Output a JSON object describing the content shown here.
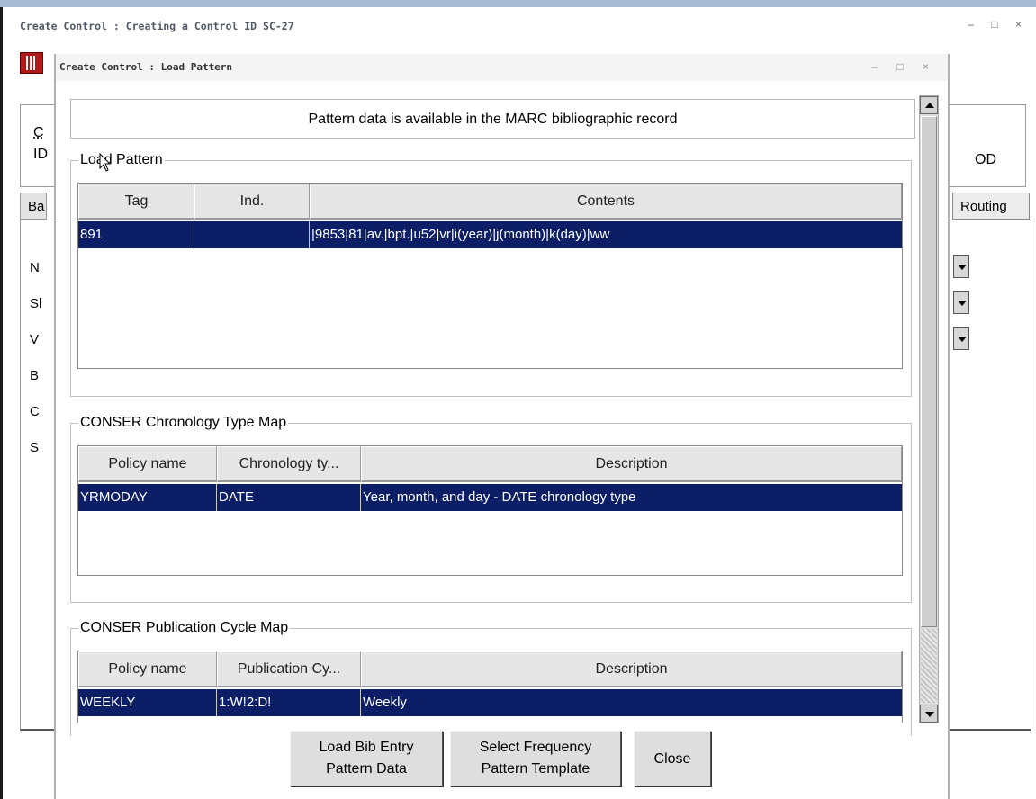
{
  "background_window": {
    "title": "Create Control : Creating a Control ID SC-27",
    "window_controls": "–  □  ×",
    "panel_label_1": "C",
    "panel_label_2": "ID",
    "panel_right_text": "OD",
    "tab_left": "Ba",
    "tab_right": "Routing",
    "side_labels": [
      "N",
      "Sl",
      "V",
      "B",
      "C",
      "S"
    ]
  },
  "dialog": {
    "title": "Create Control : Load Pattern",
    "window_controls": "–  □  ×",
    "info_text": "Pattern data is available in the MARC bibliographic record",
    "load_pattern": {
      "legend": "Load Pattern",
      "columns": [
        "Tag",
        "Ind.",
        "Contents"
      ],
      "rows": [
        {
          "tag": "891",
          "ind": "",
          "contents": "|9853|81|av.|bpt.|u52|vr|i(year)|j(month)|k(day)|ww"
        }
      ]
    },
    "chronology_map": {
      "legend": "CONSER Chronology Type Map",
      "columns": [
        "Policy name",
        "Chronology ty...",
        "Description"
      ],
      "rows": [
        {
          "policy": "YRMODAY",
          "type": "DATE",
          "description": "Year, month, and day - DATE chronology type"
        }
      ]
    },
    "publication_map": {
      "legend": "CONSER Publication Cycle Map",
      "columns": [
        "Policy name",
        "Publication Cy...",
        "Description"
      ],
      "rows": [
        {
          "policy": "WEEKLY",
          "cycle": "1:W!2:D!",
          "description": "Weekly"
        }
      ]
    },
    "buttons": {
      "load_bib_line1": "Load Bib Entry",
      "load_bib_line2": "Pattern Data",
      "select_freq_line1": "Select Frequency",
      "select_freq_line2": "Pattern Template",
      "close": "Close"
    },
    "selection_color": "#0c1e66"
  }
}
